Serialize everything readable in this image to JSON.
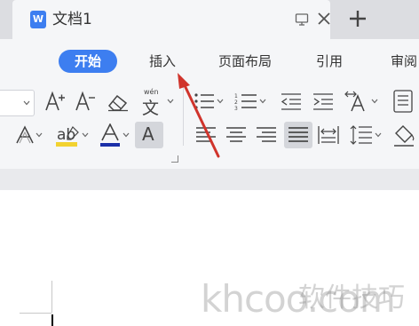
{
  "tab": {
    "title": "文档1",
    "icon_letter": "W"
  },
  "menu": {
    "items": [
      {
        "label": "开始",
        "active": true
      },
      {
        "label": "插入",
        "active": false
      },
      {
        "label": "页面布局",
        "active": false
      },
      {
        "label": "引用",
        "active": false
      },
      {
        "label": "审阅",
        "active": false
      }
    ]
  },
  "toolbar": {
    "phonetic_glyph_top": "wén",
    "phonetic_glyph": "文",
    "shading_glyph": "A"
  },
  "watermark": {
    "latin": "khcoo.com",
    "chinese": "软件技巧"
  },
  "colors": {
    "accent": "#3d7ef0",
    "arrow": "#d0342c",
    "font_color_bar": "#1a2fa8",
    "highlight_bar": "#f2d230"
  }
}
